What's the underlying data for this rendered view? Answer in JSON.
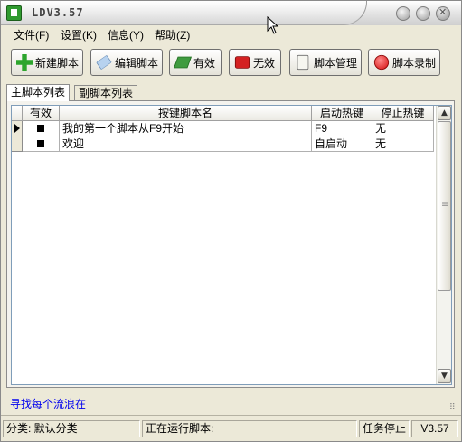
{
  "window": {
    "title": "LDV3.57"
  },
  "menu": [
    "文件(F)",
    "设置(K)",
    "信息(Y)",
    "帮助(Z)"
  ],
  "toolbar": {
    "new_script": "新建脚本",
    "edit_script": "编辑脚本",
    "enable": "有效",
    "disable": "无效",
    "script_manage": "脚本管理",
    "record_script": "脚本录制"
  },
  "tabs": {
    "main": "主脚本列表",
    "sub": "副脚本列表"
  },
  "table": {
    "headers": [
      "有效",
      "按键脚本名",
      "启动热键",
      "停止热键"
    ],
    "rows": [
      {
        "enabled": true,
        "name": "我的第一个脚本从F9开始",
        "start_hotkey": "F9",
        "stop_hotkey": "无"
      },
      {
        "enabled": true,
        "name": "欢迎",
        "start_hotkey": "自启动",
        "stop_hotkey": "无"
      }
    ]
  },
  "link": "寻找每个流浪在",
  "status": {
    "category": "分类: 默认分类",
    "running": "正在运行脚本:",
    "task_state": "任务停止",
    "version": "V3.57"
  },
  "icons": {
    "app": "app-icon",
    "new": "plus-icon",
    "edit": "pencil-icon",
    "enable": "green-book-icon",
    "disable": "red-book-icon",
    "manage": "document-icon",
    "record": "record-icon"
  }
}
